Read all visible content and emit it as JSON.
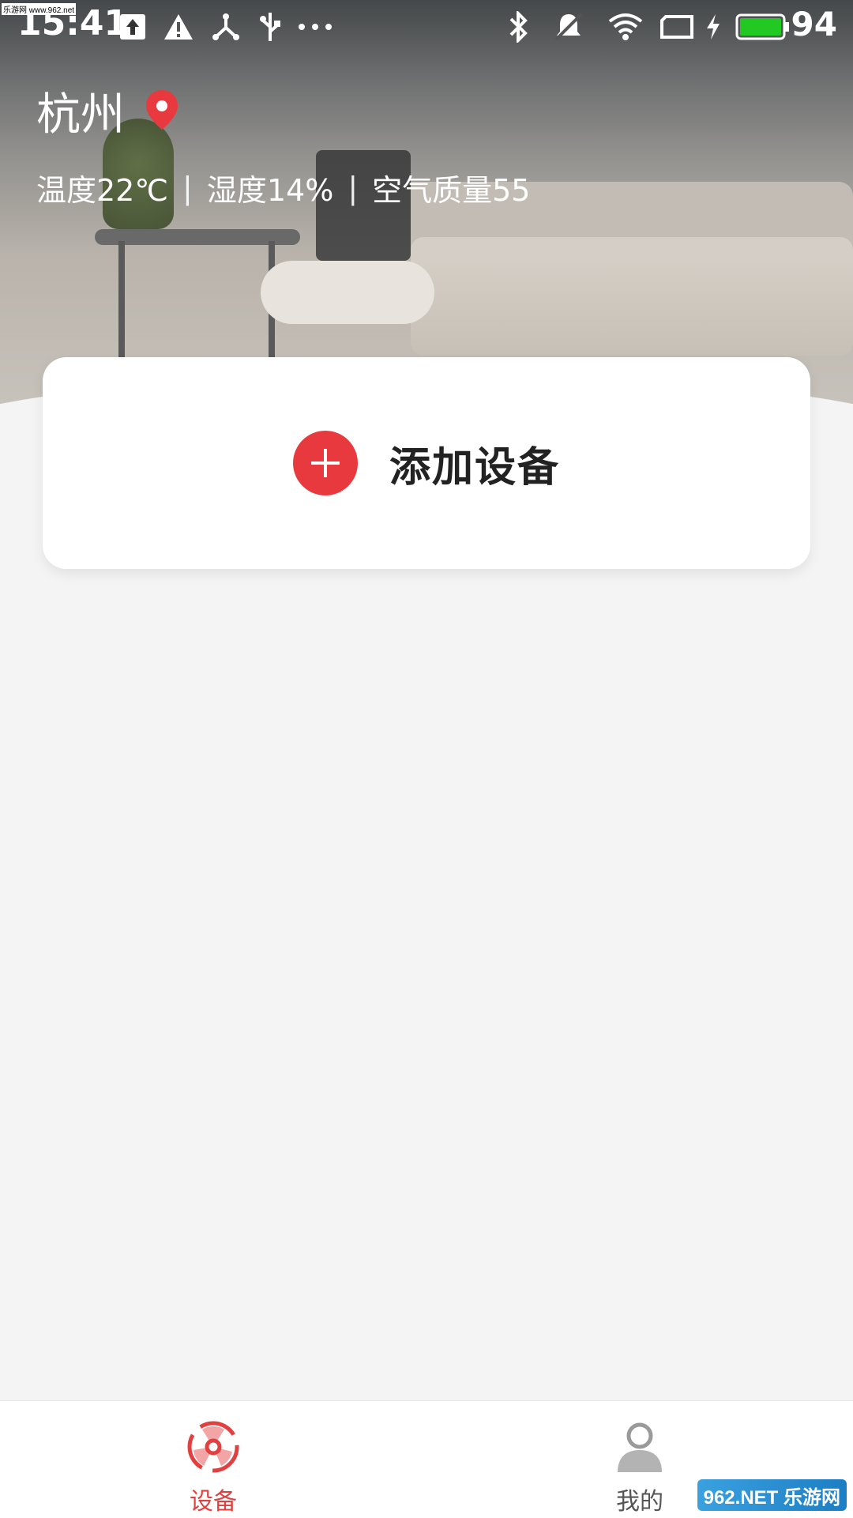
{
  "status_bar": {
    "time": "15:41",
    "battery_percent": "94",
    "icons": [
      "upload-icon",
      "warning-icon",
      "hub-icon",
      "usb-icon",
      "more-dots-icon",
      "bluetooth-icon",
      "mute-icon",
      "wifi-icon",
      "screen-icon",
      "charging-icon",
      "battery-icon"
    ],
    "battery_color": "#22c922"
  },
  "header": {
    "city": "杭州",
    "location_icon_color": "#e8393f",
    "weather": {
      "temperature": "温度22℃",
      "humidity": "湿度14%",
      "air_quality": "空气质量55",
      "separator": "|"
    }
  },
  "main": {
    "add_device_label": "添加设备",
    "accent_color": "#e8393f"
  },
  "bottom_nav": {
    "items": [
      {
        "label": "设备",
        "icon": "device-fan-icon",
        "active": true
      },
      {
        "label": "我的",
        "icon": "profile-icon",
        "active": false
      }
    ],
    "active_color": "#e0403f"
  },
  "watermarks": {
    "top": "乐游网 www.962.net",
    "bottom": "962.NET 乐游网"
  }
}
